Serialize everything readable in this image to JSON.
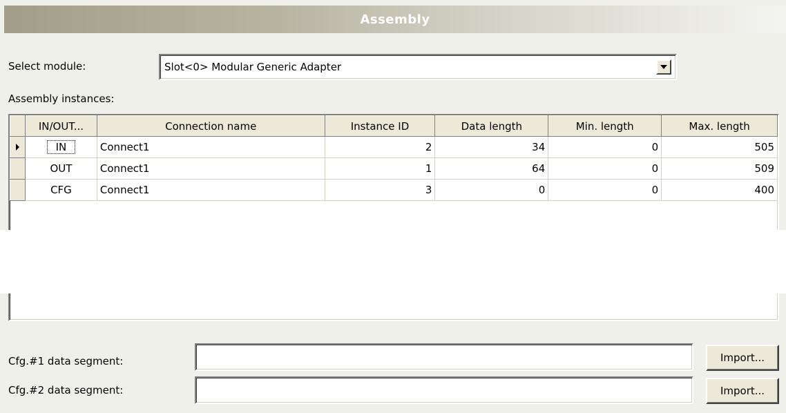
{
  "title": "Assembly",
  "select_module": {
    "label": "Select module:",
    "value": "Slot<0> Modular Generic Adapter"
  },
  "instances_label": "Assembly instances:",
  "columns": [
    "IN/OUT...",
    "Connection name",
    "Instance ID",
    "Data length",
    "Min. length",
    "Max. length"
  ],
  "rows": [
    {
      "io": "IN",
      "name": "Connect1",
      "instance_id": "2",
      "data_length": "34",
      "min_length": "0",
      "max_length": "505"
    },
    {
      "io": "OUT",
      "name": "Connect1",
      "instance_id": "1",
      "data_length": "64",
      "min_length": "0",
      "max_length": "509"
    },
    {
      "io": "CFG",
      "name": "Connect1",
      "instance_id": "3",
      "data_length": "0",
      "min_length": "0",
      "max_length": "400"
    }
  ],
  "cfg1": {
    "label": "Cfg.#1 data segment:",
    "value": "",
    "button": "Import..."
  },
  "cfg2": {
    "label": "Cfg.#2 data segment:",
    "value": "",
    "button": "Import..."
  }
}
